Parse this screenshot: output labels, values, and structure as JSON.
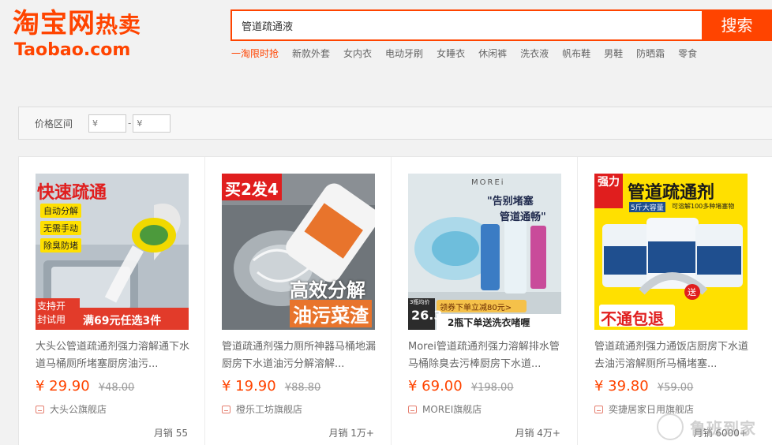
{
  "header": {
    "logo_main": "淘宝网",
    "logo_suffix": "热卖",
    "logo_en": "Taobao.com",
    "search_value": "管道疏通液",
    "search_button": "搜索",
    "hotwords": [
      "一淘限时抢",
      "新款外套",
      "女内衣",
      "电动牙刷",
      "女睡衣",
      "休闲裤",
      "洗衣液",
      "帆布鞋",
      "男鞋",
      "防晒霜",
      "零食"
    ]
  },
  "filter": {
    "label": "价格区间",
    "min_placeholder": "¥",
    "max_placeholder": "¥",
    "separator": "-"
  },
  "products": [
    {
      "image_text": {
        "top": "快速疏通",
        "checks": [
          "自动分解",
          "无需手动",
          "除臭防堵"
        ],
        "bottom_left": "支持开\n封试用",
        "bottom_right": "满69元任选3件"
      },
      "title": "大头公管道疏通剂强力溶解通下水道马桶厕所堵塞厨房油污...",
      "price": "¥ 29.90",
      "original_price": "¥48.00",
      "shop": "大头公旗舰店",
      "sales": "月销 55"
    },
    {
      "image_text": {
        "top": "买2发4",
        "mid": "高效分解",
        "bottom": "油污菜渣"
      },
      "title": "管道疏通剂强力厕所神器马桶地漏厨房下水道油污分解溶解...",
      "price": "¥ 19.90",
      "original_price": "¥88.80",
      "shop": "橙乐工坊旗舰店",
      "sales": "月销 1万+"
    },
    {
      "image_text": {
        "brand": "MOREi",
        "slogan1": "\"告别堵塞",
        "slogan2": "管道通畅\"",
        "price_small": "3瓶均价",
        "price_big": "26.3",
        "coupon": "领券下单立减80元>",
        "promo": "2瓶下单送洗衣啫喱"
      },
      "title": "Morei管道疏通剂强力溶解排水管马桶除臭去污棒厨房下水道...",
      "price": "¥ 69.00",
      "original_price": "¥198.00",
      "shop": "MOREI旗舰店",
      "sales": "月销 4万+"
    },
    {
      "image_text": {
        "tag": "强力",
        "top": "管道疏通剂",
        "sub1": "5斤大容量",
        "sub2": "可溶解100多种堵塞物",
        "bottom": "不通包退",
        "gift": "送"
      },
      "title": "管道疏通剂强力通饭店厨房下水道去油污溶解厕所马桶堵塞...",
      "price": "¥ 39.80",
      "original_price": "¥59.00",
      "shop": "奕捷居家日用旗舰店",
      "sales": "月销 6000+"
    }
  ],
  "watermark": "鲁班到家",
  "colors": {
    "brand": "#ff4400",
    "price": "#ff4400"
  }
}
